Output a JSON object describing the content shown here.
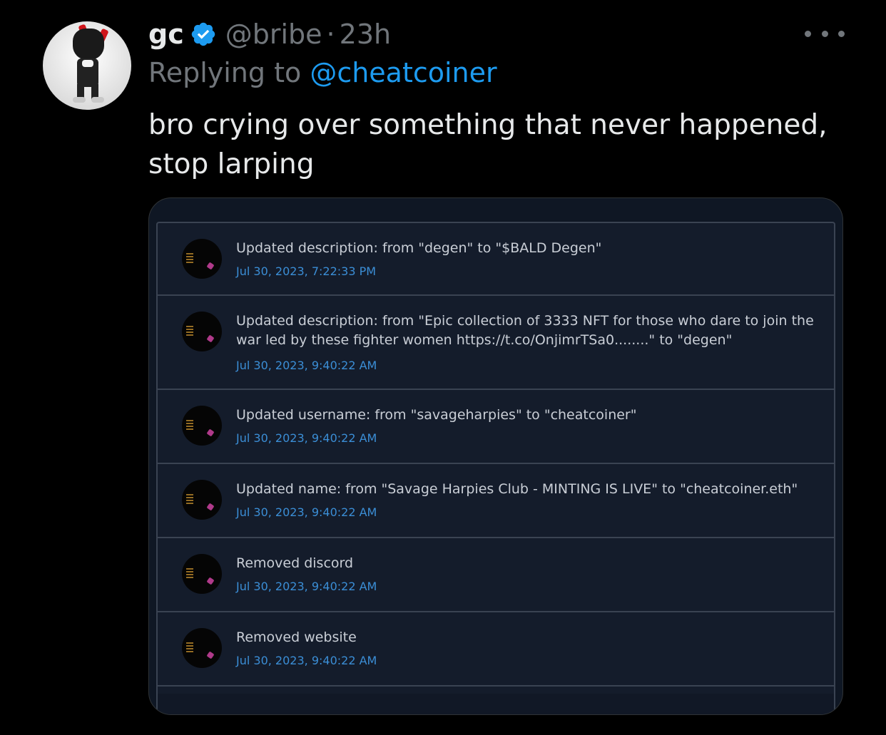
{
  "tweet": {
    "display_name": "gc",
    "handle": "@bribe",
    "separator": "·",
    "time": "23h",
    "replying_prefix": "Replying to ",
    "replying_to": "@cheatcoiner",
    "text": "bro crying over something that never happened, stop larping"
  },
  "colors": {
    "background": "#000000",
    "text_primary": "#e7e9ea",
    "text_secondary": "#71767b",
    "accent": "#1d9bf0",
    "panel_background": "#141c2b",
    "panel_border": "#3a4352",
    "entry_date": "#3b8ed6"
  },
  "icons": {
    "verified": "verified-badge-icon",
    "more": "more-options-icon"
  },
  "log_entries": [
    {
      "text": "Updated description: from \"degen\" to \"$BALD Degen\"",
      "date": "Jul 30, 2023, 7:22:33 PM"
    },
    {
      "text": "Updated description: from \"Epic collection of 3333 NFT for those who dare to join the war led by these fighter women https://t.co/OnjimrTSa0........\" to \"degen\"",
      "date": "Jul 30, 2023, 9:40:22 AM"
    },
    {
      "text": "Updated username: from \"savageharpies\" to \"cheatcoiner\"",
      "date": "Jul 30, 2023, 9:40:22 AM"
    },
    {
      "text": "Updated name: from \"Savage Harpies Club - MINTING IS LIVE\" to \"cheatcoiner.eth\"",
      "date": "Jul 30, 2023, 9:40:22 AM"
    },
    {
      "text": "Removed discord",
      "date": "Jul 30, 2023, 9:40:22 AM"
    },
    {
      "text": "Removed website",
      "date": "Jul 30, 2023, 9:40:22 AM"
    }
  ]
}
